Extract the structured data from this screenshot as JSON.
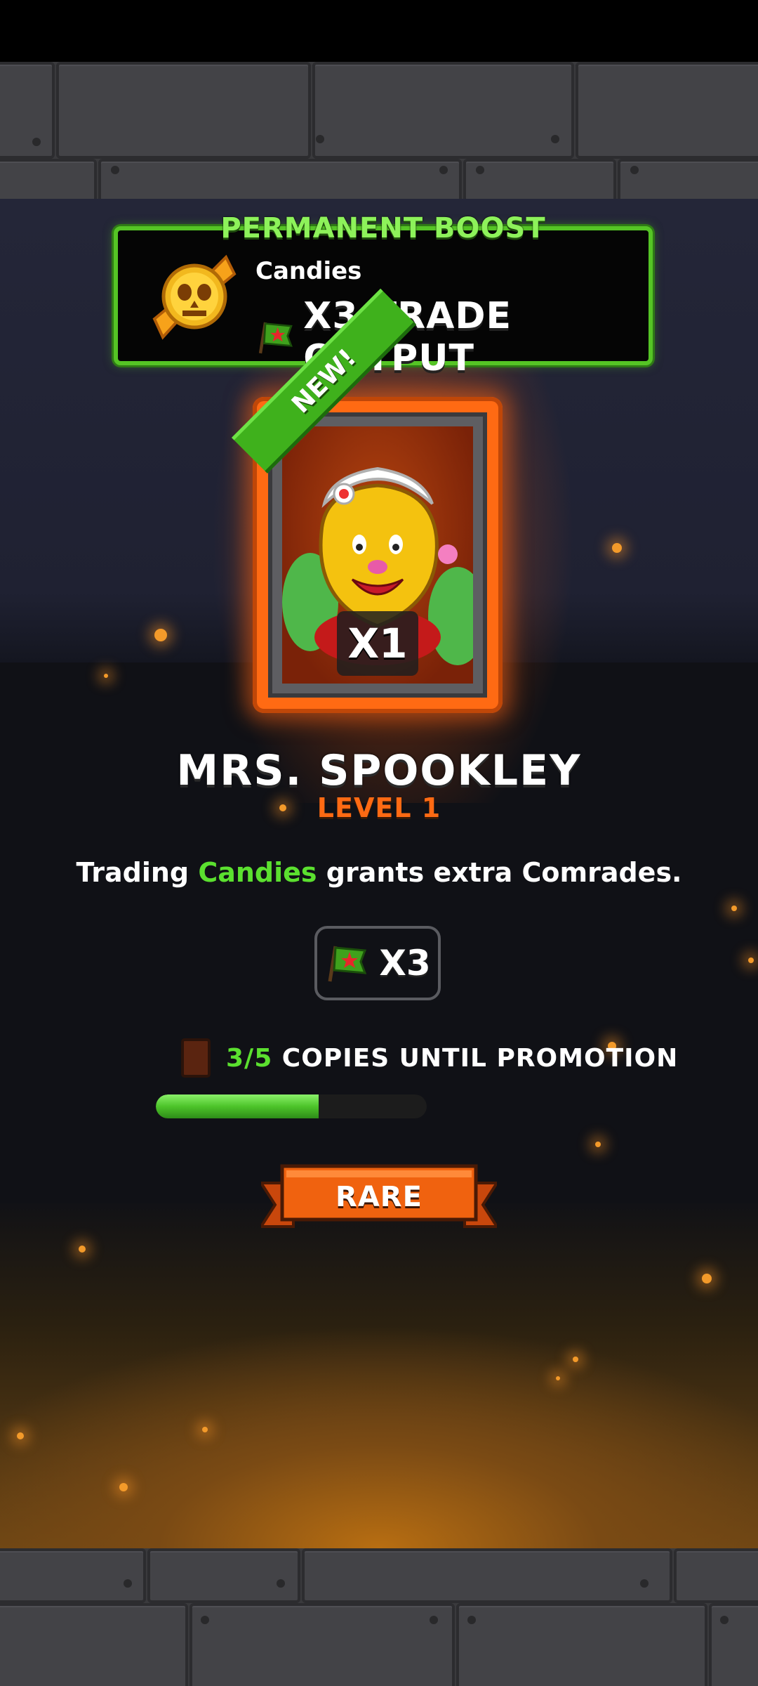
{
  "boost": {
    "title": "PERMANENT BOOST",
    "resource": "Candies",
    "effect": "X3 TRADE OUTPUT",
    "candy_icon": "skull-candy-icon",
    "flag_icon": "red-star-flag-icon"
  },
  "card": {
    "badge": "NEW!",
    "count": "X1",
    "character_art": "pepper-lady-character"
  },
  "character": {
    "name": "MRS. SPOOKLEY",
    "level": "LEVEL 1"
  },
  "description": {
    "prefix": "Trading",
    "highlight": "Candies",
    "suffix": "grants extra Comrades."
  },
  "multiplier": {
    "value": "X3",
    "icon": "red-star-flag-icon"
  },
  "promotion": {
    "count": "3/5",
    "label": "COPIES UNTIL PROMOTION",
    "progress": 0.6
  },
  "rarity": {
    "label": "RARE"
  },
  "colors": {
    "accent_green": "#5be02f",
    "accent_orange": "#ff6a13",
    "background": "#101116"
  }
}
